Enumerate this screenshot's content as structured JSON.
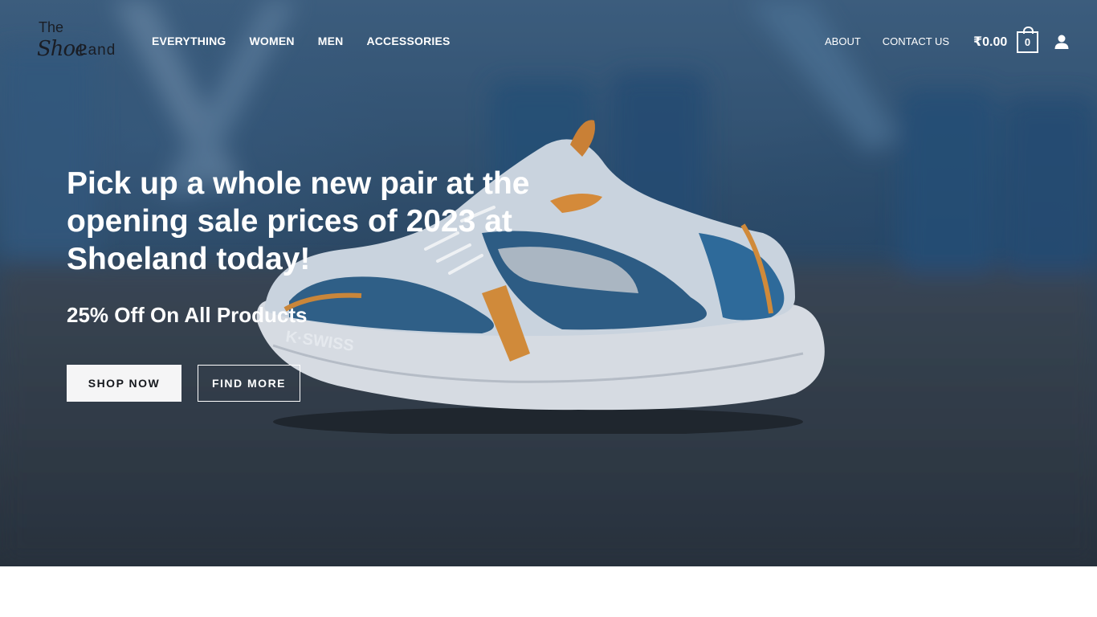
{
  "logo": {
    "line1": "The",
    "line2": "Shoe",
    "line3": "Land"
  },
  "nav": {
    "main": [
      "EVERYTHING",
      "WOMEN",
      "MEN",
      "ACCESSORIES"
    ],
    "right": [
      "ABOUT",
      "CONTACT US"
    ]
  },
  "cart": {
    "total": "₹0.00",
    "count": "0"
  },
  "hero": {
    "headline": "Pick up a whole new pair at the opening sale prices of 2023 at Shoeland today!",
    "subheadline": "25% Off On All Products",
    "primary_button": "SHOP NOW",
    "secondary_button": "FIND MORE"
  },
  "shoe_brand_text": "K·SWISS",
  "icons": {
    "user": "user-icon",
    "cart": "shopping-bag-icon"
  },
  "colors": {
    "button_bg": "#f5f5f6",
    "text_light": "#ffffff",
    "overlay": "#35536f"
  }
}
